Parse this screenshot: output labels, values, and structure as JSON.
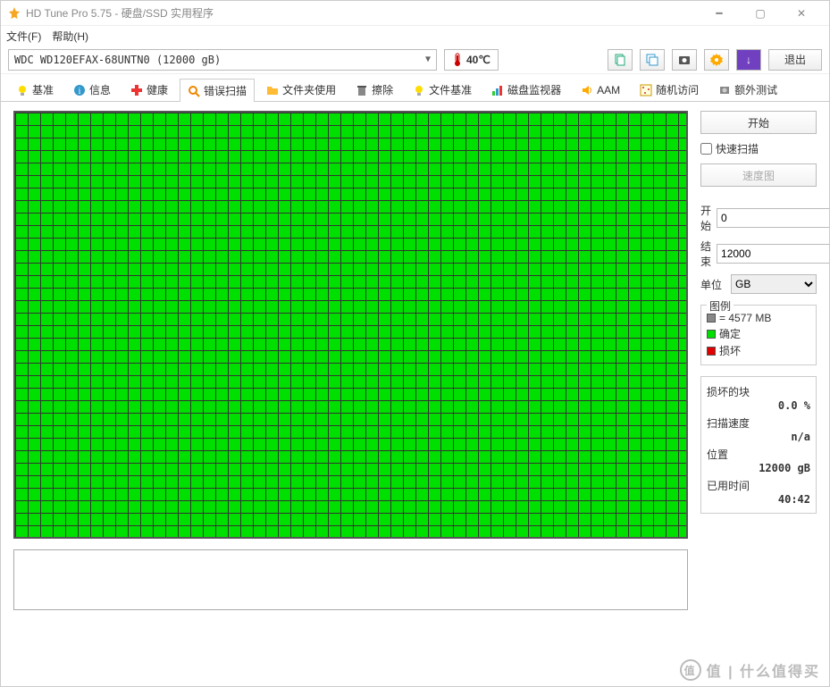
{
  "window": {
    "title": "HD Tune Pro 5.75 - 硬盘/SSD 实用程序"
  },
  "menubar": {
    "file": "文件(F)",
    "help": "帮助(H)"
  },
  "toolbar": {
    "drive_selected": "WDC WD120EFAX-68UNTN0 (12000 gB)",
    "temperature": "40℃",
    "exit_label": "退出"
  },
  "tabs": {
    "benchmark": "基准",
    "info": "信息",
    "health": "健康",
    "errorscan": "错误扫描",
    "folder": "文件夹使用",
    "erase": "擦除",
    "filebench": "文件基准",
    "monitor": "磁盘监视器",
    "aam": "AAM",
    "random": "随机访问",
    "extra": "额外测试"
  },
  "side": {
    "start_btn": "开始",
    "quick_scan": "快速扫描",
    "speedmap_btn": "速度图",
    "start_label": "开始",
    "start_value": "0",
    "end_label": "结束",
    "end_value": "12000",
    "unit_label": "单位",
    "unit_value": "GB"
  },
  "legend": {
    "title": "图例",
    "block_equals": "= 4577 MB",
    "ok": "确定",
    "damaged": "损坏"
  },
  "stats": {
    "damaged_label": "损坏的块",
    "damaged_value": "0.0 %",
    "speed_label": "扫描速度",
    "speed_value": "n/a",
    "position_label": "位置",
    "position_value": "12000 gB",
    "elapsed_label": "已用时间",
    "elapsed_value": "40:42"
  },
  "colors": {
    "ok": "#00E000",
    "damaged": "#E00000",
    "neutral": "#888888"
  },
  "watermark": "值 | 什么值得买"
}
